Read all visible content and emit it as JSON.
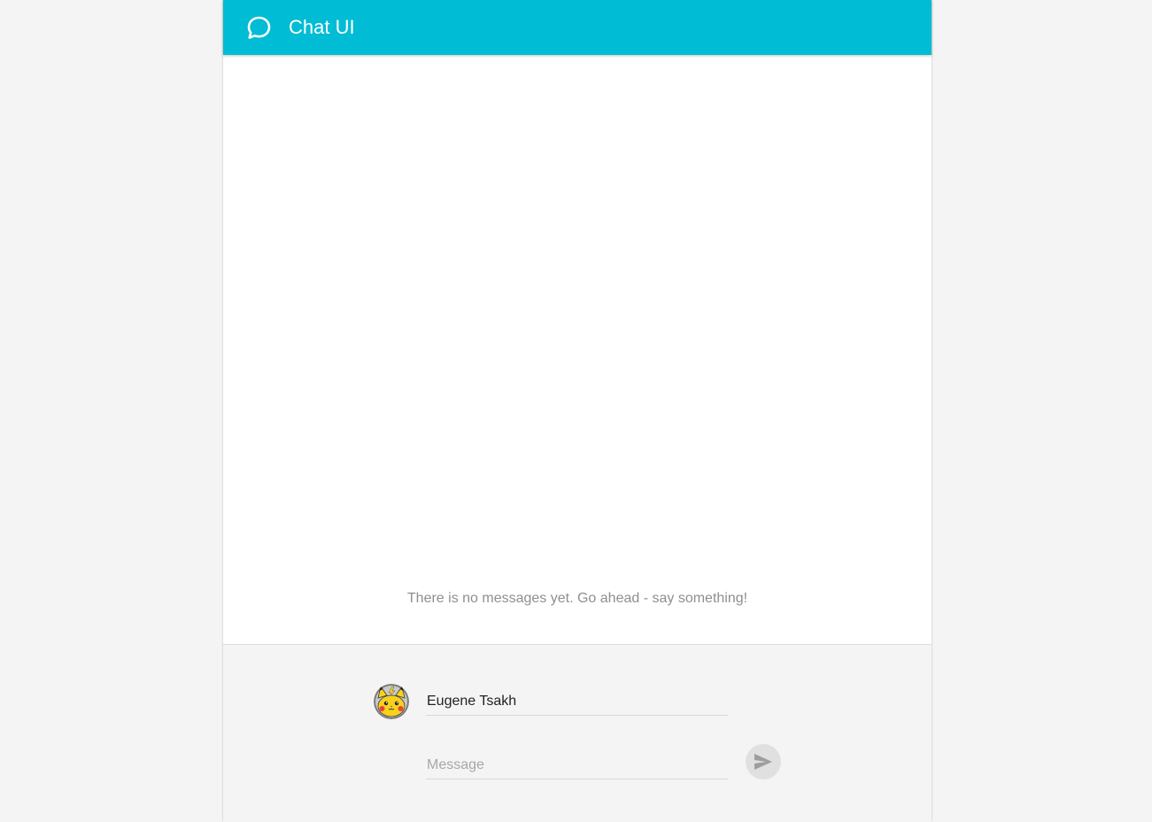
{
  "app_bar": {
    "title": "Chat UI",
    "icon": "chat-bubble-icon",
    "color": "#00bcd4"
  },
  "messages": {
    "items": [],
    "empty_text": "There is no messages yet. Go ahead - say something!"
  },
  "composer": {
    "avatar_icon": "pikachu-avatar",
    "name_value": "Eugene Tsakh",
    "message_value": "",
    "message_placeholder": "Message",
    "send_icon": "send-icon"
  }
}
